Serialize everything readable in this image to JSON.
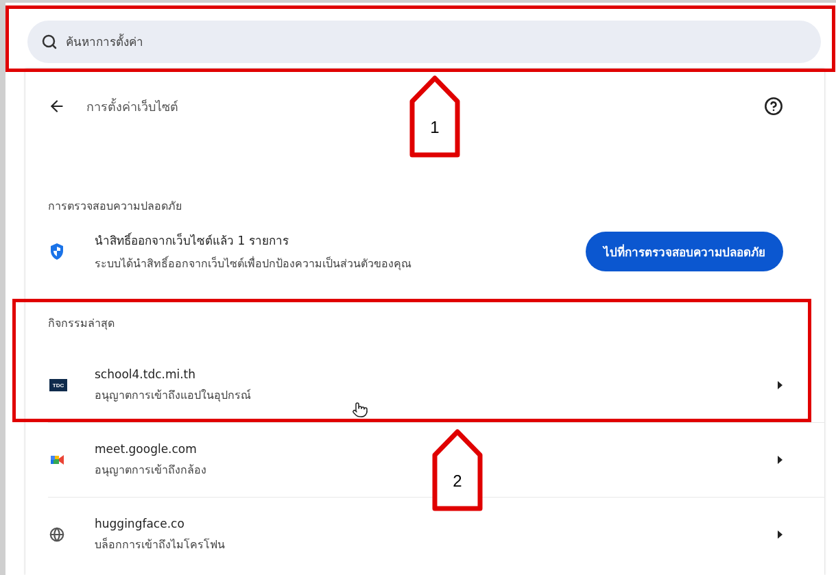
{
  "search": {
    "placeholder": "ค้นหาการตั้งค่า"
  },
  "header": {
    "title": "การตั้งค่าเว็บไซต์"
  },
  "safety_check": {
    "heading": "การตรวจสอบความปลอดภัย",
    "title": "นำสิทธิ์ออกจากเว็บไซต์แล้ว 1 รายการ",
    "description": "ระบบได้นำสิทธิ์ออกจากเว็บไซต์เพื่อปกป้องความเป็นส่วนตัวของคุณ",
    "button": "ไปที่การตรวจสอบความปลอดภัย"
  },
  "recent_activity": {
    "heading": "กิจกรรมล่าสุด",
    "sites": [
      {
        "kind": "logo",
        "logo_text": "TDC",
        "site": "school4.tdc.mi.th",
        "permission": "อนุญาตการเข้าถึงแอปในอุปกรณ์"
      },
      {
        "kind": "camera",
        "site": "meet.google.com",
        "permission": "อนุญาตการเข้าถึงกล้อง"
      },
      {
        "kind": "globe",
        "site": "huggingface.co",
        "permission": "บล็อกการเข้าถึงไมโครโฟน"
      }
    ]
  },
  "annotations": [
    {
      "label": "1"
    },
    {
      "label": "2"
    }
  ]
}
